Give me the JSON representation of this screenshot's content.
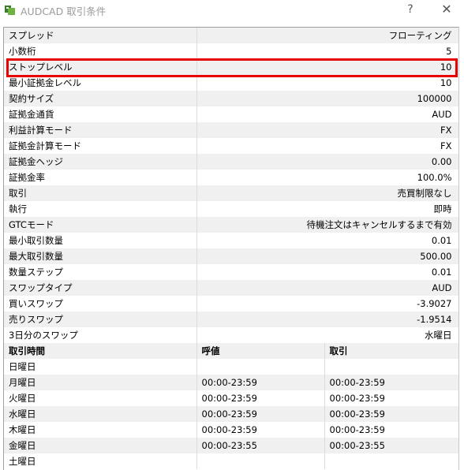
{
  "window": {
    "title": "AUDCAD 取引条件",
    "help_label": "?",
    "close_label": "✕"
  },
  "properties": [
    {
      "name": "スプレッド",
      "value": "フローティング"
    },
    {
      "name": "小数桁",
      "value": "5"
    },
    {
      "name": "ストップレベル",
      "value": "10"
    },
    {
      "name": "最小証拠金レベル",
      "value": "10"
    },
    {
      "name": "契約サイズ",
      "value": "100000"
    },
    {
      "name": "証拠金通貨",
      "value": "AUD"
    },
    {
      "name": "利益計算モード",
      "value": "FX"
    },
    {
      "name": "証拠金計算モード",
      "value": "FX"
    },
    {
      "name": "証拠金ヘッジ",
      "value": "0.00"
    },
    {
      "name": "証拠金率",
      "value": "100.0%"
    },
    {
      "name": "取引",
      "value": "売買制限なし"
    },
    {
      "name": "執行",
      "value": "即時"
    },
    {
      "name": "GTCモード",
      "value": "待機注文はキャンセルするまで有効"
    },
    {
      "name": "最小取引数量",
      "value": "0.01"
    },
    {
      "name": "最大取引数量",
      "value": "500.00"
    },
    {
      "name": "数量ステップ",
      "value": "0.01"
    },
    {
      "name": "スワップタイプ",
      "value": "AUD"
    },
    {
      "name": "買いスワップ",
      "value": "-3.9027"
    },
    {
      "name": "売りスワップ",
      "value": "-1.9514"
    },
    {
      "name": "3日分のスワップ",
      "value": "水曜日"
    }
  ],
  "schedule": {
    "headers": [
      "取引時間",
      "呼値",
      "取引"
    ],
    "rows": [
      {
        "day": "日曜日",
        "quotes": "",
        "trades": ""
      },
      {
        "day": "月曜日",
        "quotes": "00:00-23:59",
        "trades": "00:00-23:59"
      },
      {
        "day": "火曜日",
        "quotes": "00:00-23:59",
        "trades": "00:00-23:59"
      },
      {
        "day": "水曜日",
        "quotes": "00:00-23:59",
        "trades": "00:00-23:59"
      },
      {
        "day": "木曜日",
        "quotes": "00:00-23:59",
        "trades": "00:00-23:59"
      },
      {
        "day": "金曜日",
        "quotes": "00:00-23:55",
        "trades": "00:00-23:55"
      },
      {
        "day": "土曜日",
        "quotes": "",
        "trades": ""
      }
    ]
  },
  "colors": {
    "highlight": "#e60000",
    "row_shade": "#f0f0f0"
  }
}
